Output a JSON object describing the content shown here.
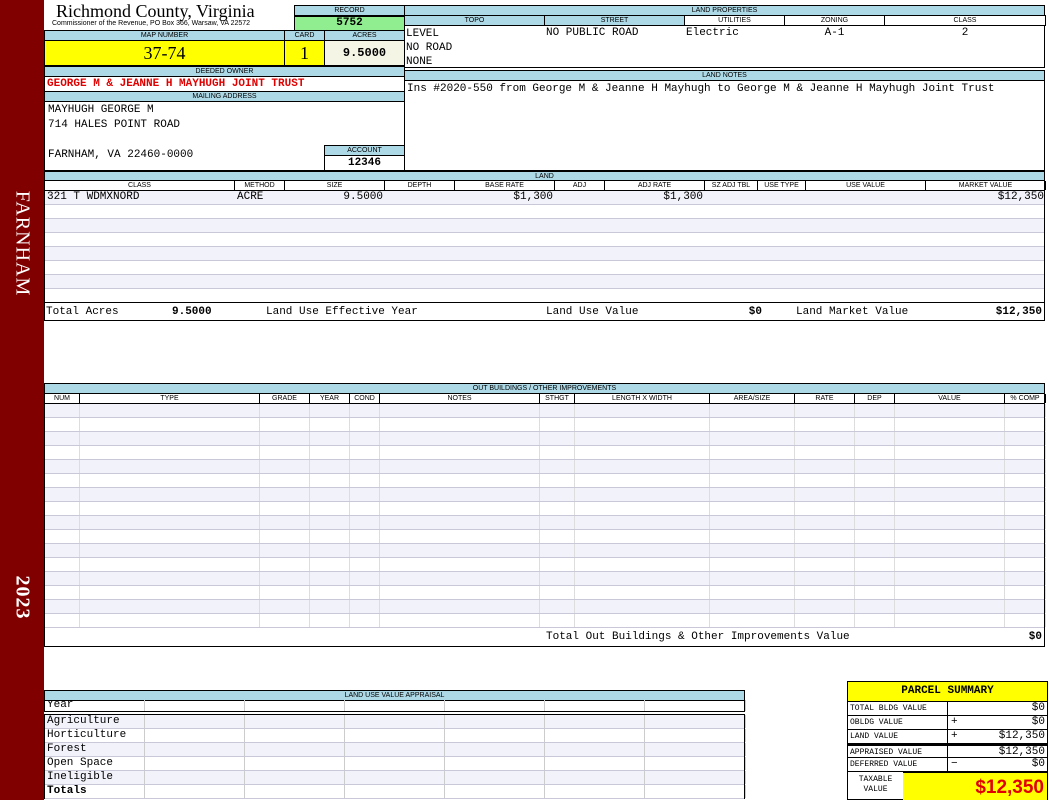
{
  "sidebar": {
    "location": "FARNHAM",
    "year": "2023",
    "color": "#800000"
  },
  "header": {
    "title": "Richmond County, Virginia",
    "subtitle": "Commissioner of the Revenue, PO Box 366, Warsaw, VA 22572"
  },
  "record": {
    "label": "RECORD",
    "value": "5752"
  },
  "map": {
    "map_label": "MAP NUMBER",
    "map_value": "37-74",
    "card_label": "CARD",
    "card_value": "1",
    "acres_label": "ACRES",
    "acres_value": "9.5000"
  },
  "owner": {
    "label": "DEEDED OWNER",
    "value": "GEORGE M & JEANNE H MAYHUGH JOINT TRUST"
  },
  "mailing": {
    "label": "MAILING ADDRESS",
    "line1": "MAYHUGH GEORGE M",
    "line2": "714 HALES POINT ROAD",
    "line3": "FARNHAM, VA 22460-0000"
  },
  "account": {
    "label": "ACCOUNT",
    "value": "12346"
  },
  "land_properties": {
    "title": "LAND PROPERTIES",
    "columns": [
      "TOPO",
      "STREET",
      "UTILITIES",
      "ZONING",
      "CLASS"
    ],
    "topo": [
      "LEVEL",
      "NO ROAD",
      "NONE"
    ],
    "street": "NO PUBLIC ROAD",
    "utilities": "Electric",
    "zoning": "A-1",
    "class": "2"
  },
  "land_notes": {
    "title": "LAND NOTES",
    "text": "Ins #2020-550 from George M & Jeanne H Mayhugh to George M & Jeanne H Mayhugh Joint Trust"
  },
  "land": {
    "title": "LAND",
    "columns": [
      "CLASS",
      "METHOD",
      "SIZE",
      "DEPTH",
      "BASE RATE",
      "ADJ",
      "ADJ RATE",
      "SZ ADJ TBL",
      "USE TYPE",
      "USE VALUE",
      "MARKET VALUE"
    ],
    "rows": [
      [
        "321 T WDMXNORD",
        "ACRE",
        "9.5000",
        "",
        "$1,300",
        "",
        "$1,300",
        "",
        "",
        "",
        "$12,350"
      ]
    ],
    "totals": {
      "acres_label": "Total Acres",
      "acres": "9.5000",
      "effective_year_label": "Land Use Effective Year",
      "effective_year": "",
      "use_value_label": "Land Use Value",
      "use_value": "$0",
      "market_value_label": "Land Market Value",
      "market_value": "$12,350"
    }
  },
  "outbuildings": {
    "title": "OUT BUILDINGS / OTHER IMPROVEMENTS",
    "columns": [
      "NUM",
      "TYPE",
      "GRADE",
      "YEAR",
      "COND",
      "NOTES",
      "STHGT",
      "LENGTH X WIDTH",
      "AREA/SIZE",
      "RATE",
      "DEP",
      "VALUE",
      "% COMP"
    ],
    "total_label": "Total Out Buildings & Other Improvements Value",
    "total": "$0"
  },
  "land_use": {
    "title": "LAND USE VALUE APPRAISAL",
    "year_label": "Year",
    "rows": [
      "Agriculture",
      "Horticulture",
      "Forest",
      "Open Space",
      "Ineligible"
    ],
    "totals_label": "Totals"
  },
  "parcel_summary": {
    "title": "PARCEL SUMMARY",
    "rows": [
      {
        "label": "TOTAL BLDG VALUE",
        "op": "",
        "value": "$0"
      },
      {
        "label": "OBLDG VALUE",
        "op": "+",
        "value": "$0"
      },
      {
        "label": "LAND VALUE",
        "op": "+",
        "value": "$12,350"
      },
      {
        "label": "APPRAISED VALUE",
        "op": "",
        "value": "$12,350"
      },
      {
        "label": "DEFERRED VALUE",
        "op": "−",
        "value": "$0"
      }
    ],
    "taxable_label": "TAXABLE VALUE",
    "taxable_value": "$12,350"
  }
}
